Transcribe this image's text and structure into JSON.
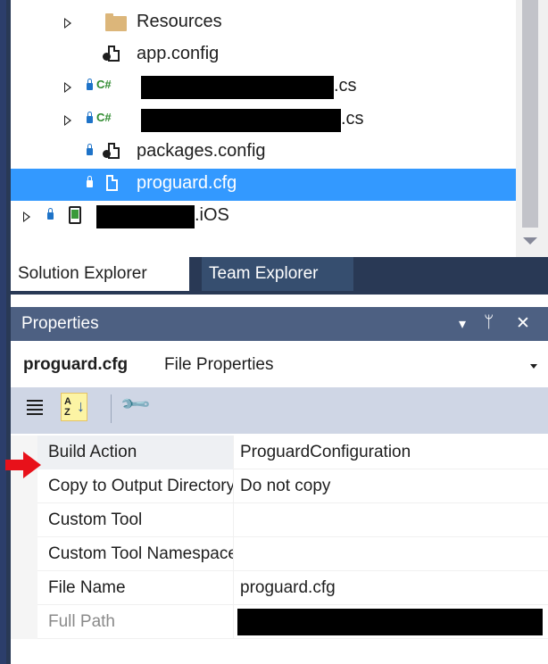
{
  "solution_explorer": {
    "items": [
      {
        "label": "Resources"
      },
      {
        "label": "app.config"
      },
      {
        "label": ".cs"
      },
      {
        "label": ".cs"
      },
      {
        "label": "packages.config"
      },
      {
        "label": "proguard.cfg"
      },
      {
        "label": ".iOS"
      }
    ],
    "cs_badge": "C#"
  },
  "tabs": [
    {
      "label": "Solution Explorer"
    },
    {
      "label": "Team Explorer"
    }
  ],
  "properties": {
    "title": "Properties",
    "object_name": "proguard.cfg",
    "object_type": "File Properties",
    "rows": [
      {
        "name": "Build Action",
        "value": "ProguardConfiguration"
      },
      {
        "name": "Copy to Output Directory",
        "value": "Do not copy"
      },
      {
        "name": "Custom Tool",
        "value": ""
      },
      {
        "name": "Custom Tool Namespace",
        "value": ""
      },
      {
        "name": "File Name",
        "value": "proguard.cfg"
      },
      {
        "name": "Full Path",
        "value": ""
      }
    ]
  },
  "icons": {
    "title_dropdown": "▾",
    "pin": "ᛘ",
    "close": "✕",
    "wrench": "🔧"
  },
  "colors": {
    "selection": "#3399ff",
    "tab_bar": "#293955",
    "props_title": "#4d6082",
    "arrow": "#e8111a"
  }
}
